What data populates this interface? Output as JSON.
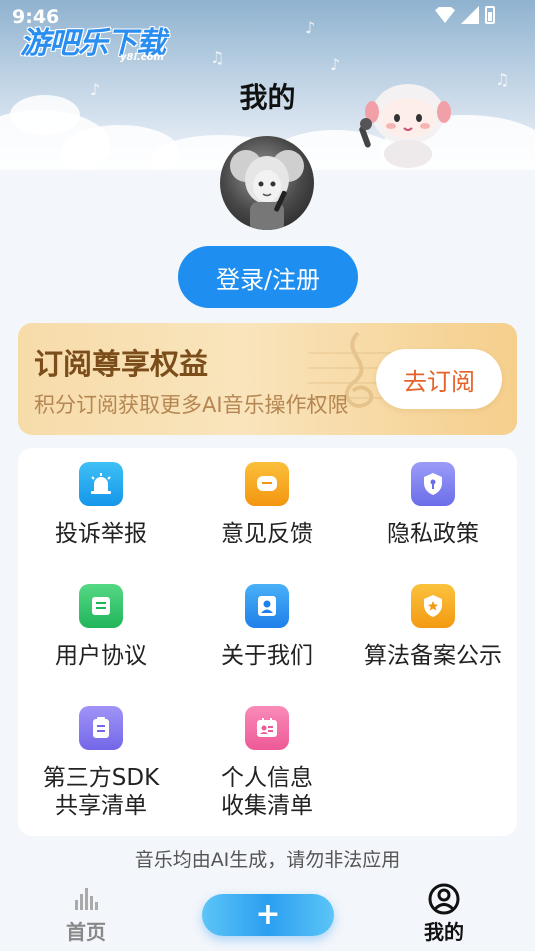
{
  "status_bar": {
    "time": "9:46"
  },
  "watermark": {
    "text": "游吧乐下载",
    "sub": "y8l.com"
  },
  "header": {
    "title": "我的"
  },
  "login": {
    "label": "登录/注册"
  },
  "subscription": {
    "title": "订阅尊享权益",
    "description": "积分订阅获取更多AI音乐操作权限",
    "button_label": "去订阅"
  },
  "menu": {
    "items": [
      {
        "label": "投诉举报",
        "icon": "alarm-icon",
        "color": "#1aa3f0"
      },
      {
        "label": "意见反馈",
        "icon": "feedback-icon",
        "color": "#f7a21c"
      },
      {
        "label": "隐私政策",
        "icon": "privacy-shield-icon",
        "color": "#7d7ef0"
      },
      {
        "label": "用户协议",
        "icon": "agreement-icon",
        "color": "#35c46a"
      },
      {
        "label": "关于我们",
        "icon": "about-user-icon",
        "color": "#2a93f0"
      },
      {
        "label": "算法备案公示",
        "icon": "algorithm-badge-icon",
        "color": "#f6a823"
      },
      {
        "label": "第三方SDK\n共享清单",
        "line1": "第三方SDK",
        "line2": "共享清单",
        "icon": "sdk-list-icon",
        "color": "#8a7cf0"
      },
      {
        "label": "个人信息\n收集清单",
        "line1": "个人信息",
        "line2": "收集清单",
        "icon": "personal-info-icon",
        "color": "#f46fa6"
      }
    ]
  },
  "disclaimer": "音乐均由AI生成，请勿非法应用",
  "tab_bar": {
    "home_label": "首页",
    "mine_label": "我的",
    "add_symbol": "+"
  }
}
